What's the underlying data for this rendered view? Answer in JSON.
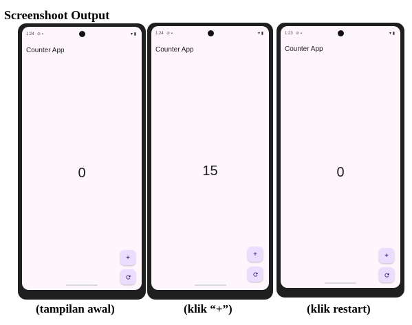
{
  "heading": "Screenshoot Output",
  "phones": [
    {
      "status_time": "1:24",
      "app_title": "Counter App",
      "counter_value": "0",
      "caption": "(tampilan awal)"
    },
    {
      "status_time": "1:24",
      "app_title": "Counter App",
      "counter_value": "15",
      "caption": "(klik “+”)"
    },
    {
      "status_time": "1:23",
      "app_title": "Counter App",
      "counter_value": "0",
      "caption": "(klik restart)"
    }
  ],
  "fab_add_label": "+",
  "icons": {
    "increment": "plus-icon",
    "reset": "refresh-icon",
    "wifi": "wifi-icon",
    "battery": "battery-icon"
  },
  "colors": {
    "screen_bg": "#fdf7fd",
    "fab_bg": "#eaddff",
    "fab_fg": "#21005d",
    "frame": "#1f1f1f"
  }
}
